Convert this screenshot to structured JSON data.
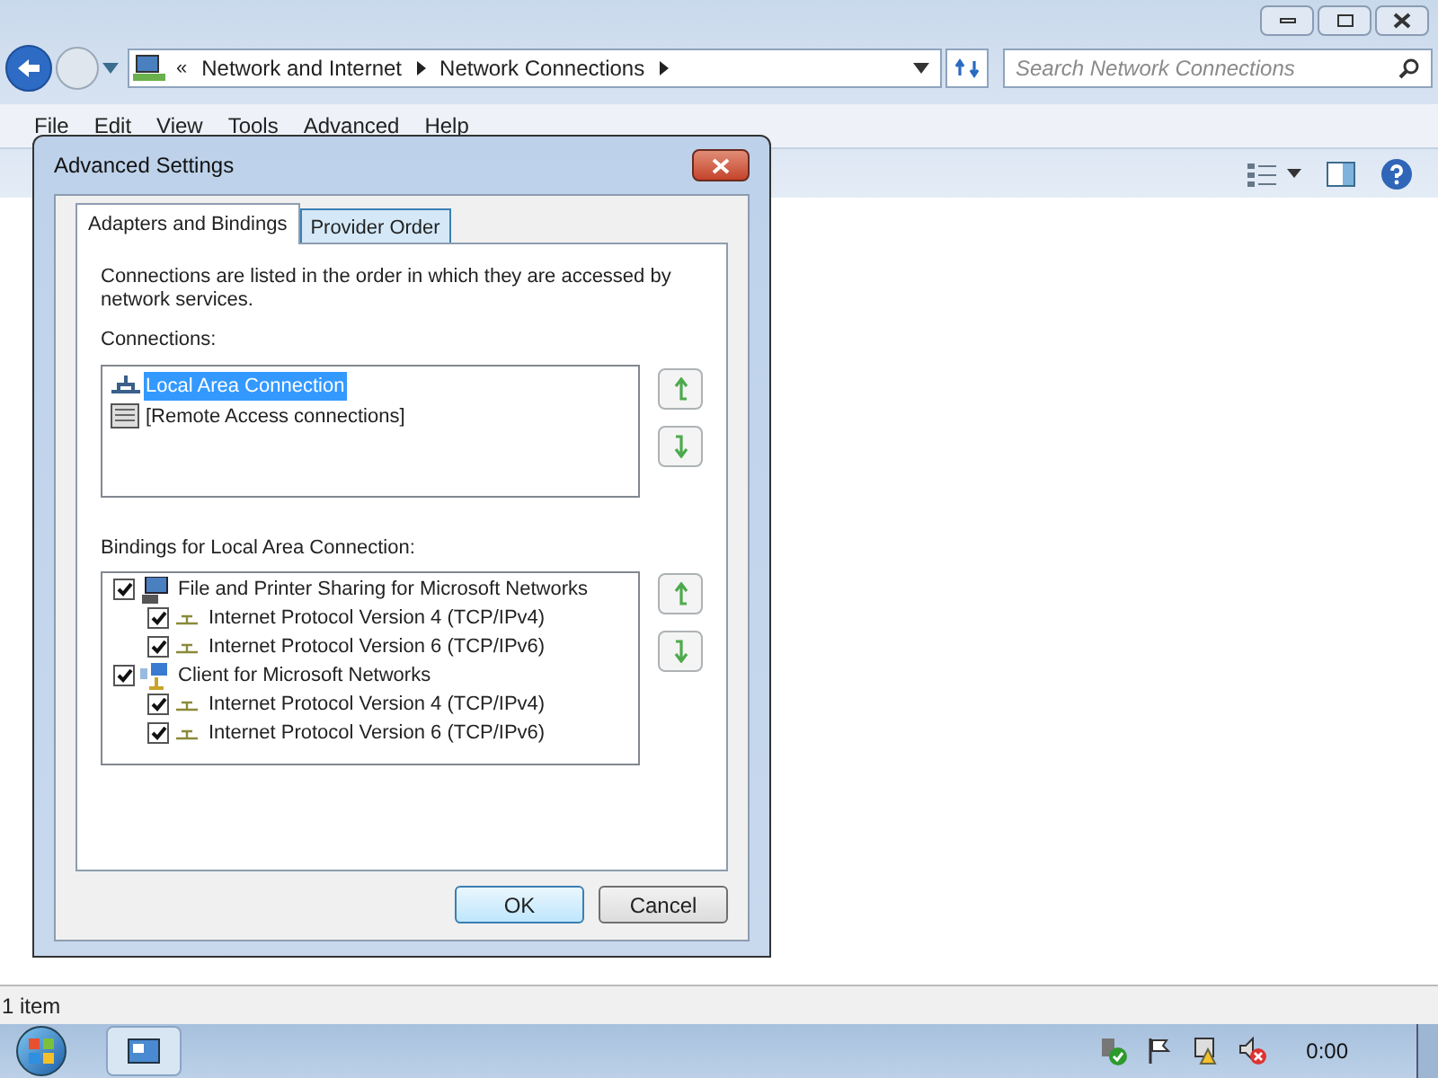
{
  "explorer": {
    "overflow": "«",
    "breadcrumbs": [
      "Network and Internet",
      "Network Connections"
    ],
    "search": {
      "placeholder": "Search Network Connections"
    },
    "menu": [
      "File",
      "Edit",
      "View",
      "Tools",
      "Advanced",
      "Help"
    ]
  },
  "dialog": {
    "title": "Advanced Settings",
    "tabs": [
      {
        "label": "Adapters and Bindings",
        "selected": true
      },
      {
        "label": "Provider Order",
        "selected": false
      }
    ],
    "description": "Connections are listed in the order in which they are accessed by network services.",
    "connections_label": "Connections:",
    "connections": [
      {
        "label": "Local Area Connection",
        "kind": "lan",
        "selected": true
      },
      {
        "label": "[Remote Access connections]",
        "kind": "remote",
        "selected": false
      }
    ],
    "bindings_label": "Bindings for Local Area Connection:",
    "bindings": [
      {
        "label": "File and Printer Sharing for Microsoft Networks",
        "kind": "service",
        "checked": true,
        "children": [
          {
            "label": "Internet Protocol Version 4 (TCP/IPv4)",
            "checked": true
          },
          {
            "label": "Internet Protocol Version 6 (TCP/IPv6)",
            "checked": true
          }
        ]
      },
      {
        "label": "Client for Microsoft Networks",
        "kind": "client",
        "checked": true,
        "children": [
          {
            "label": "Internet Protocol Version 4 (TCP/IPv4)",
            "checked": true
          },
          {
            "label": "Internet Protocol Version 6 (TCP/IPv6)",
            "checked": true
          }
        ]
      }
    ],
    "buttons": [
      "OK",
      "Cancel"
    ]
  },
  "status_bar": "1 item",
  "taskbar": {
    "clock": "0:00"
  }
}
